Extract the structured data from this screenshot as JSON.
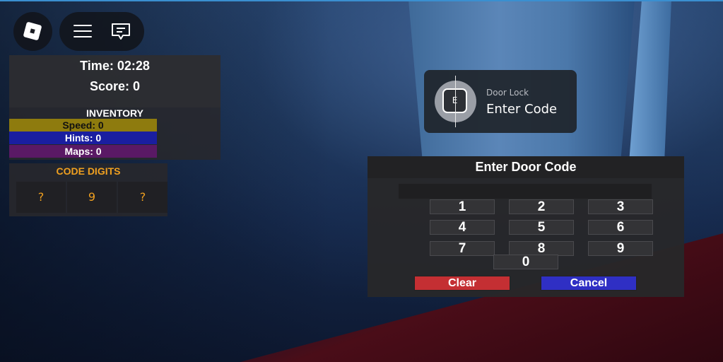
{
  "colors": {
    "speed_bar": "#8e7b0e",
    "hints_bar": "#1a1ea0",
    "maps_bar": "#5a1965",
    "code_digit": "#f0a020",
    "clear_button": "#c42f33",
    "cancel_button": "#2f2fc4"
  },
  "topbar": {
    "roblox_icon": "roblox-logo-icon",
    "menu_icon": "hamburger-menu-icon",
    "chat_icon": "chat-icon"
  },
  "stats": {
    "time": "Time: 02:28",
    "score": "Score: 0",
    "inventory_title": "INVENTORY",
    "speed": "Speed: 0",
    "hints": "Hints: 0",
    "maps": "Maps: 0"
  },
  "code_digits": {
    "title": "CODE DIGITS",
    "digits": [
      "?",
      "9",
      "?"
    ]
  },
  "prompt": {
    "key": "E",
    "object_text": "Door Lock",
    "action_text": "Enter Code"
  },
  "keypad": {
    "title": "Enter Door Code",
    "display": "",
    "keys": [
      "1",
      "2",
      "3",
      "4",
      "5",
      "6",
      "7",
      "8",
      "9",
      "0"
    ],
    "clear_label": "Clear",
    "cancel_label": "Cancel"
  }
}
